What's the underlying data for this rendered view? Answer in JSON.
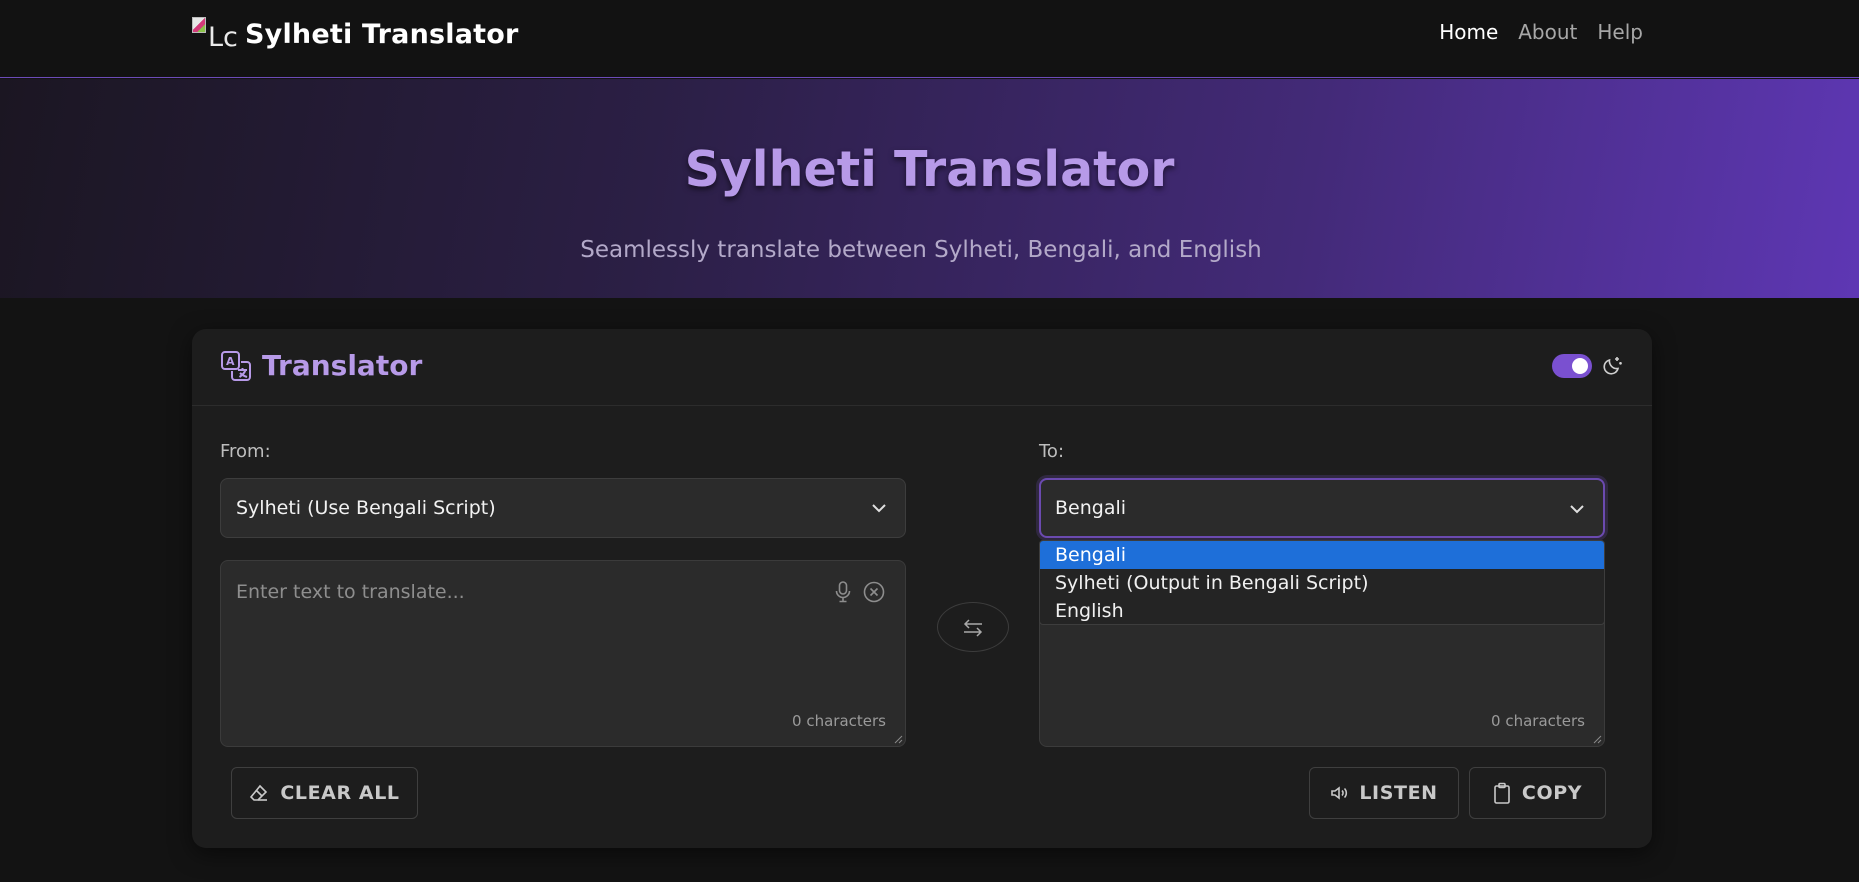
{
  "navbar": {
    "logo_alt": "Lc",
    "brand": "Sylheti Translator",
    "links": [
      "Home",
      "About",
      "Help"
    ]
  },
  "hero": {
    "title": "Sylheti Translator",
    "subtitle": "Seamlessly translate between Sylheti, Bengali, and English"
  },
  "translator": {
    "title": "Translator",
    "theme_toggle_on": true,
    "from": {
      "label": "From:",
      "selected": "Sylheti (Use Bengali Script)",
      "placeholder": "Enter text to translate...",
      "char_count": "0 characters"
    },
    "to": {
      "label": "To:",
      "selected": "Bengali",
      "options": [
        "Bengali",
        "Sylheti (Output in Bengali Script)",
        "English"
      ],
      "highlighted_option": "Bengali",
      "char_count": "0 characters"
    },
    "buttons": {
      "clear_all": "CLEAR ALL",
      "listen": "LISTEN",
      "copy": "COPY"
    }
  },
  "colors": {
    "accent": "#b79ae8",
    "toggle": "#7a50d0",
    "option_highlight": "#1e6fd9",
    "background": "#131313",
    "card": "#1d1d1d"
  },
  "icons": [
    "translate-icon",
    "moon-icon",
    "chevron-down-icon",
    "microphone-icon",
    "clear-icon",
    "swap-icon",
    "eraser-icon",
    "speaker-icon",
    "clipboard-icon"
  ]
}
